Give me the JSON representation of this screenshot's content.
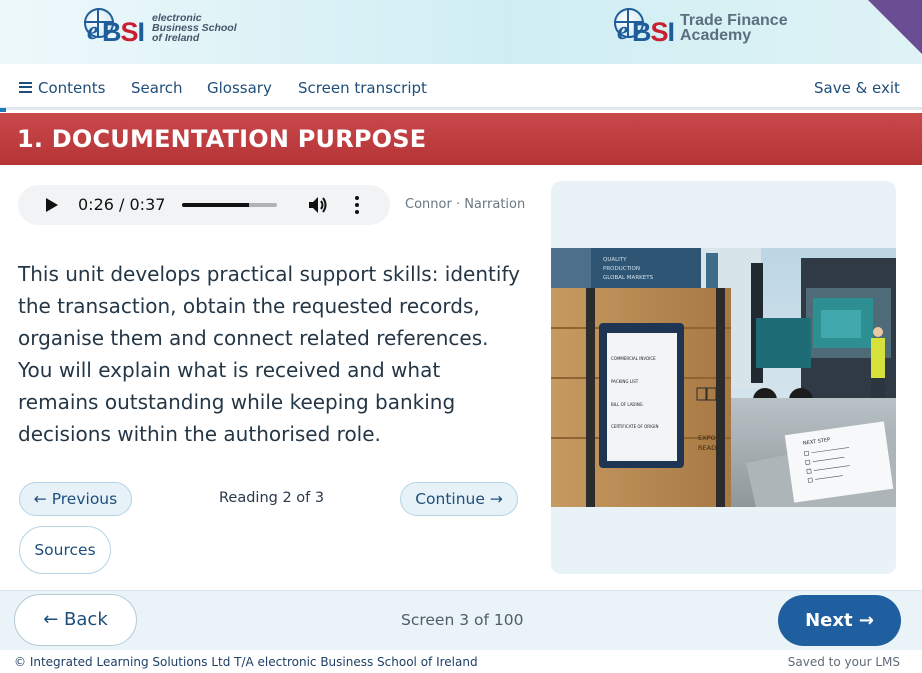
{
  "header": {
    "logo_left": {
      "mark": "BSI",
      "line1": "electronic",
      "line2": "Business School",
      "line3": "of Ireland"
    },
    "logo_right": {
      "mark": "BSI",
      "line1": "Trade Finance",
      "line2": "Academy"
    }
  },
  "nav": {
    "contents": "Contents",
    "search": "Search",
    "glossary": "Glossary",
    "transcript": "Screen transcript",
    "save_exit": "Save & exit"
  },
  "page": {
    "title": "1. DOCUMENTATION PURPOSE",
    "body": "This unit develops practical support skills: identify the transaction, obtain the requested records, organise them and connect related references. You will explain what is received and what remains outstanding while keeping banking decisions within the authorised role."
  },
  "audio": {
    "time": "0:26 / 0:37",
    "progress": 0.7,
    "narration": "Connor · Narration"
  },
  "pager": {
    "previous": "← Previous",
    "reading": "Reading 2 of 3",
    "continue": "Continue →",
    "sources": "Sources"
  },
  "photo": {
    "sign": [
      "QUALITY",
      "PRODUCTION",
      "GLOBAL MARKETS"
    ],
    "docs": [
      "COMMERCIAL INVOICE",
      "PACKING LIST",
      "BILL OF LADING",
      "CERTIFICATE OF ORIGIN"
    ],
    "crate": [
      "EXPORT",
      "READY"
    ],
    "clipboard": "NEXT STEP"
  },
  "footer": {
    "back": "← Back",
    "screen": "Screen 3 of 100",
    "next": "Next →",
    "copyright": "© Integrated Learning Solutions Ltd T/A electronic Business School of Ireland",
    "saved": "Saved to your LMS"
  },
  "colors": {
    "title_bar": "#b83a3c",
    "brand_blue": "#1f5fa0",
    "corner": "#6a4c93"
  }
}
